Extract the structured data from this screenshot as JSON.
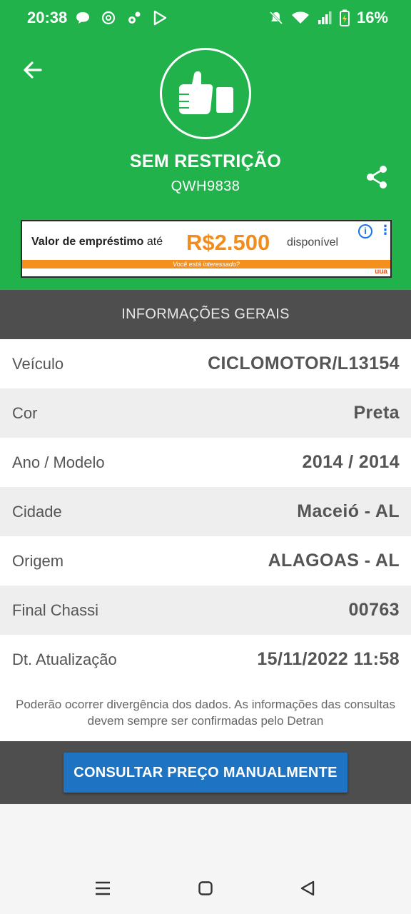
{
  "status_bar": {
    "time": "20:38",
    "battery": "16%",
    "left_icons": [
      "chat-icon",
      "openai-icon",
      "settings-sync-icon",
      "play-icon"
    ],
    "right_icons": [
      "mute-icon",
      "wifi-icon",
      "signal-icon",
      "battery-charging-icon"
    ]
  },
  "header": {
    "status_title": "SEM RESTRIÇÃO",
    "plate": "QWH9838",
    "status_icon": "thumbs-up-icon",
    "color": "#21b24c"
  },
  "ad": {
    "text_prefix": "Valor de empréstimo",
    "text_suffix_small": "até",
    "amount": "R$2.500",
    "text_after": "disponível",
    "strip_text": "Você está interessado?",
    "logo": "uua"
  },
  "section": {
    "title": "INFORMAÇÕES GERAIS"
  },
  "info_rows": [
    {
      "label": "Veículo",
      "value": "CICLOMOTOR/L13154"
    },
    {
      "label": "Cor",
      "value": "Preta"
    },
    {
      "label": "Ano / Modelo",
      "value": "2014 / 2014"
    },
    {
      "label": "Cidade",
      "value": "Maceió - AL"
    },
    {
      "label": "Origem",
      "value": "ALAGOAS - AL"
    },
    {
      "label": "Final Chassi",
      "value": "00763"
    },
    {
      "label": "Dt. Atualização",
      "value": "15/11/2022 11:58"
    }
  ],
  "disclaimer": "Poderão ocorrer divergência dos dados. As informações das consultas devem sempre ser confirmadas pelo Detran",
  "action": {
    "consult_label": "CONSULTAR PREÇO MANUALMENTE",
    "button_color": "#1e73c2"
  },
  "nav": {
    "buttons": [
      "menu-icon",
      "home-icon",
      "back-triangle-icon"
    ]
  }
}
